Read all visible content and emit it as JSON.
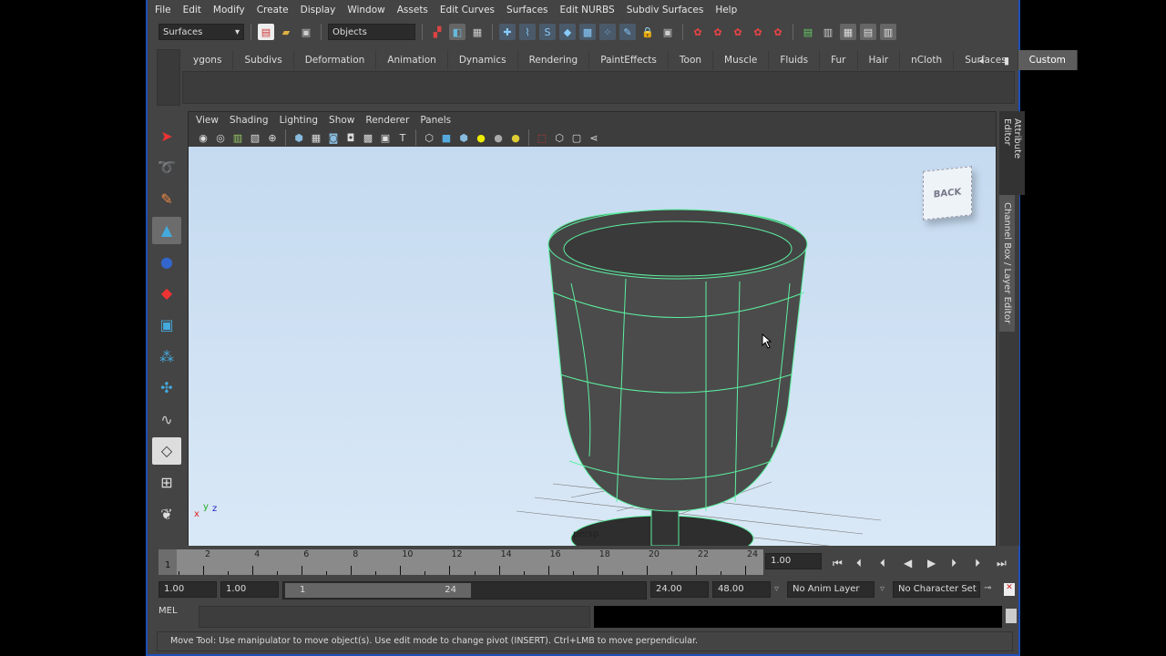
{
  "menu": [
    "File",
    "Edit",
    "Modify",
    "Create",
    "Display",
    "Window",
    "Assets",
    "Edit Curves",
    "Surfaces",
    "Edit NURBS",
    "Subdiv Surfaces",
    "Help"
  ],
  "toolbar": {
    "menuset": "Surfaces",
    "selection_mode": "Objects"
  },
  "shelf_tabs": [
    "ygons",
    "Subdivs",
    "Deformation",
    "Animation",
    "Dynamics",
    "Rendering",
    "PaintEffects",
    "Toon",
    "Muscle",
    "Fluids",
    "Fur",
    "Hair",
    "nCloth",
    "Surfaces",
    "Custom"
  ],
  "active_shelf": "Custom",
  "viewport": {
    "menu": [
      "View",
      "Shading",
      "Lighting",
      "Show",
      "Renderer",
      "Panels"
    ],
    "viewcube_label": "BACK",
    "axis": {
      "x": "x",
      "y": "y",
      "z": "z"
    },
    "grid_label": "persp"
  },
  "side_tabs": [
    "Attribute Editor",
    "Channel Box / Layer Editor"
  ],
  "timeline": {
    "current_frame": "1",
    "ticks": [
      "2",
      "4",
      "6",
      "8",
      "10",
      "12",
      "14",
      "16",
      "18",
      "20",
      "22",
      "24"
    ],
    "current_time": "1.00"
  },
  "range": {
    "start": "1.00",
    "playback_start": "1.00",
    "slider_start": "1",
    "slider_end": "24",
    "playback_end": "24.00",
    "end": "48.00",
    "anim_layer": "No Anim Layer",
    "character_set": "No Character Set"
  },
  "command_line": {
    "label": "MEL",
    "input": ""
  },
  "help_line": "Move Tool: Use manipulator to move object(s). Use edit mode to change pivot (INSERT).  Ctrl+LMB to move perpendicular.",
  "colors": {
    "wire": "#5cf0a0",
    "accent": "#1d4fb8"
  }
}
